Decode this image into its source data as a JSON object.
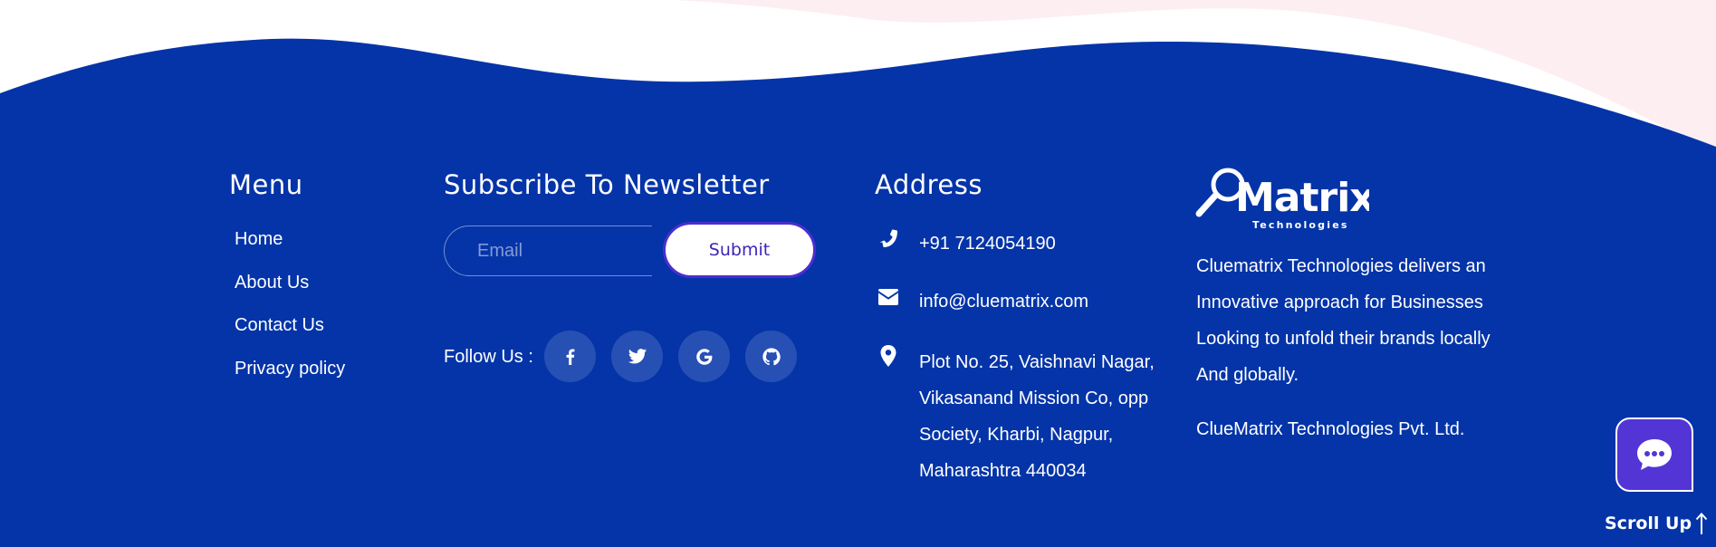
{
  "colors": {
    "footer_background": "#0434a8",
    "wave_accent": "#fdeef2",
    "submit_text": "#3b26b8",
    "chat_button": "#5335d6",
    "text": "#ffffff"
  },
  "menu": {
    "heading": "Menu",
    "items": [
      {
        "label": "Home"
      },
      {
        "label": "About Us"
      },
      {
        "label": "Contact Us"
      },
      {
        "label": "Privacy policy"
      }
    ]
  },
  "newsletter": {
    "heading": "Subscribe To Newsletter",
    "email_placeholder": "Email",
    "email_value": "",
    "submit_label": "Submit",
    "follow_label": "Follow Us :",
    "social_icons": [
      "facebook-icon",
      "twitter-icon",
      "google-icon",
      "github-icon"
    ]
  },
  "address": {
    "heading": "Address",
    "phone": "+91 7124054190",
    "email": "info@cluematrix.com",
    "location": "Plot No. 25, Vaishnavi Nagar, Vikasanand Mission Co, opp Society, Kharbi, Nagpur, Maharashtra 440034",
    "icons": [
      "phone-icon",
      "envelope-icon",
      "map-pin-icon"
    ]
  },
  "brand": {
    "logo_text": "Matrix",
    "logo_subtext": "Technologies",
    "description": "Cluematrix Technologies delivers an Innovative approach for Businesses Looking to unfold their brands locally And globally.",
    "company_name": "ClueMatrix Technologies Pvt. Ltd."
  },
  "floating": {
    "chat_icon": "chat-bubble-icon",
    "scroll_up_label": "Scroll Up",
    "scroll_icon": "arrow-up-icon"
  }
}
